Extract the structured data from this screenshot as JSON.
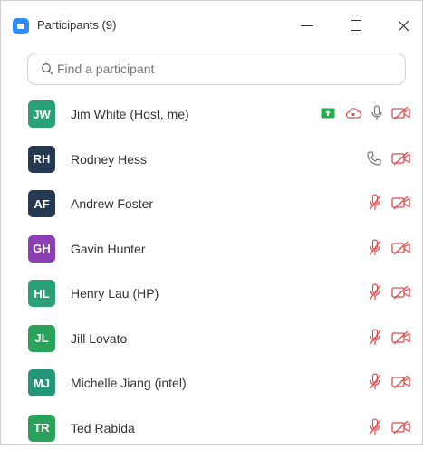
{
  "window": {
    "title": "Participants (9)"
  },
  "search": {
    "placeholder": "Find a participant"
  },
  "colors": {
    "brand": "#2d8cff",
    "muted_red": "#e24b4b",
    "green_screen": "#1fae4a"
  },
  "participants": [
    {
      "initials": "JW",
      "name": "Jim White (Host, me)",
      "avatar_color": "#2aa077",
      "icons": [
        "share-screen-icon",
        "cloud-icon",
        "microphone-icon",
        "video-off-icon"
      ]
    },
    {
      "initials": "RH",
      "name": "Rodney Hess",
      "avatar_color": "#253a52",
      "icons": [
        "phone-icon",
        "video-off-icon"
      ]
    },
    {
      "initials": "AF",
      "name": "Andrew Foster",
      "avatar_color": "#253a52",
      "icons": [
        "mic-muted-icon",
        "video-off-icon"
      ]
    },
    {
      "initials": "GH",
      "name": "Gavin Hunter",
      "avatar_color": "#8b3fb3",
      "icons": [
        "mic-muted-icon",
        "video-off-icon"
      ]
    },
    {
      "initials": "HL",
      "name": "Henry Lau (HP)",
      "avatar_color": "#2aa077",
      "icons": [
        "mic-muted-icon",
        "video-off-icon"
      ]
    },
    {
      "initials": "JL",
      "name": "Jill Lovato",
      "avatar_color": "#2aa35a",
      "icons": [
        "mic-muted-icon",
        "video-off-icon"
      ]
    },
    {
      "initials": "MJ",
      "name": "Michelle Jiang (intel)",
      "avatar_color": "#24977a",
      "icons": [
        "mic-muted-icon",
        "video-off-icon"
      ]
    },
    {
      "initials": "TR",
      "name": "Ted Rabida",
      "avatar_color": "#2aa35a",
      "icons": [
        "mic-muted-icon",
        "video-off-icon"
      ]
    }
  ]
}
